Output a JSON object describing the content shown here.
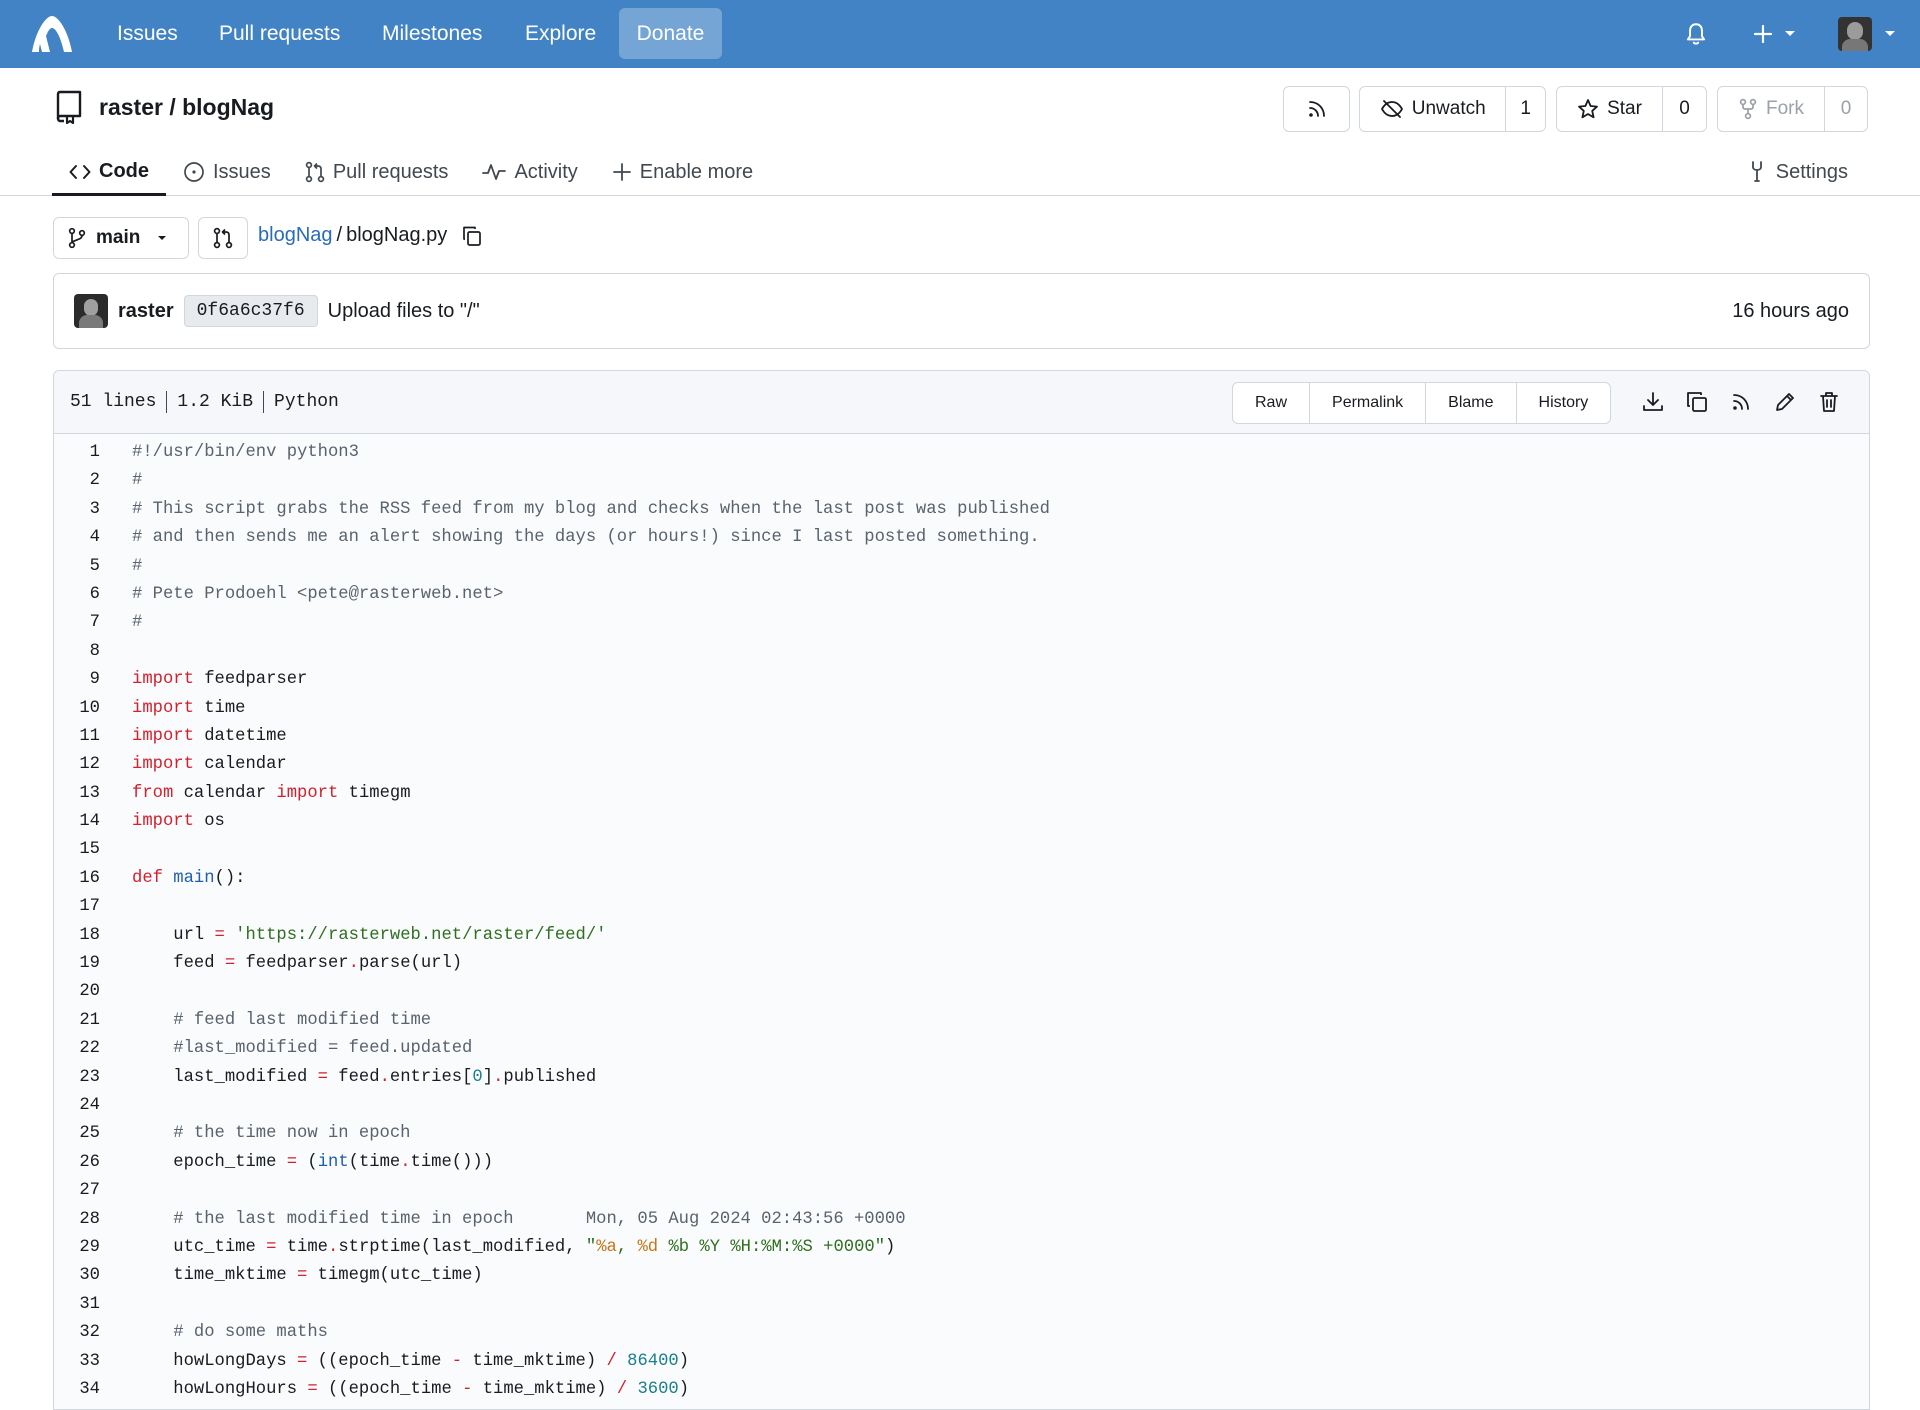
{
  "nav": {
    "items": [
      "Issues",
      "Pull requests",
      "Milestones",
      "Explore"
    ],
    "donate": "Donate"
  },
  "repo": {
    "owner": "raster",
    "name": "blogNag",
    "title": "raster / blogNag",
    "unwatch_label": "Unwatch",
    "watch_count": "1",
    "star_label": "Star",
    "star_count": "0",
    "fork_label": "Fork",
    "fork_count": "0"
  },
  "tabs": {
    "code": "Code",
    "issues": "Issues",
    "pulls": "Pull requests",
    "activity": "Activity",
    "enable_more": "Enable more",
    "settings": "Settings"
  },
  "branch": {
    "name": "main"
  },
  "path": {
    "repo": "blogNag",
    "sep": "/",
    "file": "blogNag.py"
  },
  "commit": {
    "author": "raster",
    "sha": "0f6a6c37f6",
    "message": "Upload files to \"/\"",
    "time": "16 hours ago"
  },
  "file": {
    "lines": "51 lines",
    "size": "1.2 KiB",
    "language": "Python",
    "buttons": {
      "raw": "Raw",
      "permalink": "Permalink",
      "blame": "Blame",
      "history": "History"
    }
  },
  "code_lines": [
    [
      [
        "c-com",
        "#!/usr/bin/env python3"
      ]
    ],
    [
      [
        "c-com",
        "#"
      ]
    ],
    [
      [
        "c-com",
        "# This script grabs the RSS feed from my blog and checks when the last post was published"
      ]
    ],
    [
      [
        "c-com",
        "# and then sends me an alert showing the days (or hours!) since I last posted something."
      ]
    ],
    [
      [
        "c-com",
        "#"
      ]
    ],
    [
      [
        "c-com",
        "# Pete Prodoehl <pete@rasterweb.net>"
      ]
    ],
    [
      [
        "c-com",
        "#"
      ]
    ],
    [],
    [
      [
        "c-kw",
        "import"
      ],
      [
        "",
        " feedparser"
      ]
    ],
    [
      [
        "c-kw",
        "import"
      ],
      [
        "",
        " time"
      ]
    ],
    [
      [
        "c-kw",
        "import"
      ],
      [
        "",
        " datetime"
      ]
    ],
    [
      [
        "c-kw",
        "import"
      ],
      [
        "",
        " calendar"
      ]
    ],
    [
      [
        "c-kw",
        "from"
      ],
      [
        "",
        " calendar "
      ],
      [
        "c-kw",
        "import"
      ],
      [
        "",
        " timegm"
      ]
    ],
    [
      [
        "c-kw",
        "import"
      ],
      [
        "",
        " os"
      ]
    ],
    [],
    [
      [
        "c-kw",
        "def"
      ],
      [
        "",
        " "
      ],
      [
        "c-fn",
        "main"
      ],
      [
        "",
        "():"
      ]
    ],
    [],
    [
      [
        "",
        "    url "
      ],
      [
        "c-op",
        "="
      ],
      [
        "",
        " "
      ],
      [
        "c-str",
        "'https://rasterweb.net/raster/feed/'"
      ]
    ],
    [
      [
        "",
        "    feed "
      ],
      [
        "c-op",
        "="
      ],
      [
        "",
        " feedparser"
      ],
      [
        "c-op",
        "."
      ],
      [
        "",
        "parse(url)"
      ]
    ],
    [],
    [
      [
        "c-com",
        "    # feed last modified time"
      ]
    ],
    [
      [
        "c-com",
        "    #last_modified = feed.updated"
      ]
    ],
    [
      [
        "",
        "    last_modified "
      ],
      [
        "c-op",
        "="
      ],
      [
        "",
        " feed"
      ],
      [
        "c-op",
        "."
      ],
      [
        "",
        "entries["
      ],
      [
        "c-num",
        "0"
      ],
      [
        "",
        "]"
      ],
      [
        "c-op",
        "."
      ],
      [
        "",
        "published"
      ]
    ],
    [],
    [
      [
        "c-com",
        "    # the time now in epoch"
      ]
    ],
    [
      [
        "",
        "    epoch_time "
      ],
      [
        "c-op",
        "="
      ],
      [
        "",
        " ("
      ],
      [
        "c-fn",
        "int"
      ],
      [
        "",
        "(time"
      ],
      [
        "c-op",
        "."
      ],
      [
        "",
        "time()))"
      ]
    ],
    [],
    [
      [
        "c-com",
        "    # the last modified time in epoch       Mon, 05 Aug 2024 02:43:56 +0000"
      ]
    ],
    [
      [
        "",
        "    utc_time "
      ],
      [
        "c-op",
        "="
      ],
      [
        "",
        " time"
      ],
      [
        "c-op",
        "."
      ],
      [
        "",
        "strptime(last_modified, "
      ],
      [
        "c-str",
        "\""
      ],
      [
        "c-fmt",
        "%a"
      ],
      [
        "c-str",
        ", "
      ],
      [
        "c-fmt",
        "%d"
      ],
      [
        "c-str",
        " %b %Y %H:%M:%S +0000\""
      ],
      [
        "",
        ")"
      ]
    ],
    [
      [
        "",
        "    time_mktime "
      ],
      [
        "c-op",
        "="
      ],
      [
        "",
        " timegm(utc_time)"
      ]
    ],
    [],
    [
      [
        "c-com",
        "    # do some maths"
      ]
    ],
    [
      [
        "",
        "    howLongDays "
      ],
      [
        "c-op",
        "="
      ],
      [
        "",
        " ((epoch_time "
      ],
      [
        "c-op",
        "-"
      ],
      [
        "",
        " time_mktime) "
      ],
      [
        "c-op",
        "/"
      ],
      [
        "",
        " "
      ],
      [
        "c-num",
        "86400"
      ],
      [
        "",
        ")"
      ]
    ],
    [
      [
        "",
        "    howLongHours "
      ],
      [
        "c-op",
        "="
      ],
      [
        "",
        " ((epoch_time "
      ],
      [
        "c-op",
        "-"
      ],
      [
        "",
        " time_mktime) "
      ],
      [
        "c-op",
        "/"
      ],
      [
        "",
        " "
      ],
      [
        "c-num",
        "3600"
      ],
      [
        "",
        ")"
      ]
    ]
  ]
}
